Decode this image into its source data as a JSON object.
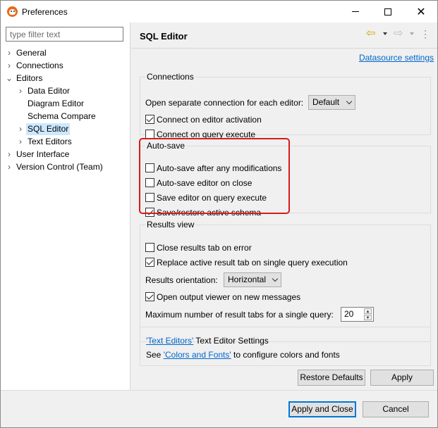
{
  "window": {
    "title": "Preferences"
  },
  "sidebar": {
    "filter_placeholder": "type filter text",
    "items": [
      {
        "label": "General",
        "arrow": ">"
      },
      {
        "label": "Connections",
        "arrow": ">"
      },
      {
        "label": "Editors",
        "arrow": "v"
      },
      {
        "label": "Data Editor",
        "arrow": ">"
      },
      {
        "label": "Diagram Editor",
        "arrow": ""
      },
      {
        "label": "Schema Compare",
        "arrow": ""
      },
      {
        "label": "SQL Editor",
        "arrow": ">",
        "selected": true
      },
      {
        "label": "Text Editors",
        "arrow": ">"
      },
      {
        "label": "User Interface",
        "arrow": ">"
      },
      {
        "label": "Version Control (Team)",
        "arrow": ">"
      }
    ]
  },
  "page": {
    "title": "SQL Editor",
    "datasource_link": "Datasource settings",
    "connections": {
      "legend": "Connections",
      "separate_label": "Open separate connection for each editor:",
      "separate_value": "Default",
      "connect_on_activation": {
        "label": "Connect on editor activation",
        "checked": true
      },
      "connect_on_execute": {
        "label": "Connect on query execute",
        "checked": false
      }
    },
    "autosave": {
      "legend": "Auto-save",
      "after_modifications": {
        "label": "Auto-save after any modifications",
        "checked": false
      },
      "editor_on_close": {
        "label": "Auto-save editor on close",
        "checked": false
      },
      "on_query_execute": {
        "label": "Save editor on query execute",
        "checked": false
      },
      "restore_schema": {
        "label": "Save/restore active schema",
        "checked": true
      }
    },
    "results": {
      "legend": "Results view",
      "close_on_error": {
        "label": "Close results tab on error",
        "checked": false
      },
      "replace_active": {
        "label": "Replace active result tab on single query execution",
        "checked": true
      },
      "orientation_label": "Results orientation:",
      "orientation_value": "Horizontal",
      "open_output": {
        "label": "Open output viewer on new messages",
        "checked": true
      },
      "max_tabs_label": "Maximum number of result tabs for a single query:",
      "max_tabs_value": "20"
    },
    "links": {
      "text_editors_link": "'Text Editors'",
      "text_editors_suffix": "Text Editor Settings",
      "see_prefix": "See",
      "colors_link": "'Colors and Fonts'",
      "colors_suffix": "to configure colors and fonts"
    },
    "restore_defaults": "Restore Defaults",
    "apply": "Apply"
  },
  "footer": {
    "apply_close": "Apply and Close",
    "cancel": "Cancel"
  },
  "colors": {
    "highlight": "#d81a1a",
    "selection": "#cce8ff",
    "link": "#0066cc",
    "default_button": "#0078d7"
  }
}
